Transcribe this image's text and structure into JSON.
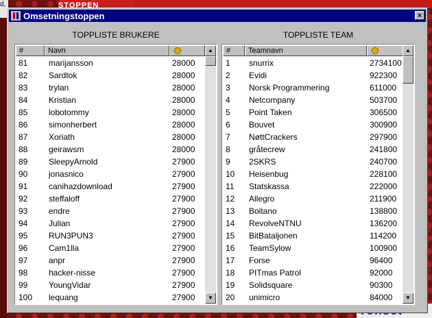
{
  "background": {
    "banner_text": "STOPPEN",
    "corner_text": "d,",
    "bottom_text": "rohset"
  },
  "window": {
    "title": "Omsetningstoppen",
    "close_label": "×"
  },
  "users": {
    "panel_title": "TOPPLISTE BRUKERE",
    "col_rank": "#",
    "col_name": "Navn",
    "col_score_icon": "gold-coin-icon",
    "rows": [
      [
        "81",
        "marijansson",
        "28000"
      ],
      [
        "82",
        "Sardtok",
        "28000"
      ],
      [
        "83",
        "trylan",
        "28000"
      ],
      [
        "84",
        "Kristian",
        "28000"
      ],
      [
        "85",
        "lobotommy",
        "28000"
      ],
      [
        "86",
        "simonherbert",
        "28000"
      ],
      [
        "87",
        "Xoriath",
        "28000"
      ],
      [
        "88",
        "geirawsm",
        "28000"
      ],
      [
        "89",
        "SleepyArnold",
        "27900"
      ],
      [
        "90",
        "jonasnico",
        "27900"
      ],
      [
        "91",
        "canihazdownload",
        "27900"
      ],
      [
        "92",
        "steffaloff",
        "27900"
      ],
      [
        "93",
        "endre",
        "27900"
      ],
      [
        "94",
        "Julian",
        "27900"
      ],
      [
        "95",
        "RUN3PUN3",
        "27900"
      ],
      [
        "96",
        "Cam1lla",
        "27900"
      ],
      [
        "97",
        "anpr",
        "27900"
      ],
      [
        "98",
        "hacker-nisse",
        "27900"
      ],
      [
        "99",
        "YoungVidar",
        "27900"
      ],
      [
        "100",
        "lequang",
        "27900"
      ]
    ]
  },
  "teams": {
    "panel_title": "TOPPLISTE TEAM",
    "col_rank": "#",
    "col_name": "Teamnavn",
    "col_score_icon": "gold-coin-icon",
    "rows": [
      [
        "1",
        "snurrix",
        "2734100"
      ],
      [
        "2",
        "Evidi",
        "922300"
      ],
      [
        "3",
        "Norsk Programmering",
        "611000"
      ],
      [
        "4",
        "Netcompany",
        "503700"
      ],
      [
        "5",
        "Point Taken",
        "306500"
      ],
      [
        "6",
        "Bouvet",
        "300900"
      ],
      [
        "7",
        "NøttCrackers",
        "297900"
      ],
      [
        "8",
        "gråtecrew",
        "241800"
      ],
      [
        "9",
        "2SKRS",
        "240700"
      ],
      [
        "10",
        "Heisenbug",
        "228100"
      ],
      [
        "11",
        "Statskassa",
        "222000"
      ],
      [
        "12",
        "Allegro",
        "211900"
      ],
      [
        "13",
        "Boitano",
        "138800"
      ],
      [
        "14",
        "RevolveNTNU",
        "136200"
      ],
      [
        "15",
        "BitBataljonen",
        "114200"
      ],
      [
        "16",
        "TeamSylow",
        "100900"
      ],
      [
        "17",
        "Forse",
        "96400"
      ],
      [
        "18",
        "PITmas Patrol",
        "92000"
      ],
      [
        "19",
        "Solidsquare",
        "90300"
      ],
      [
        "20",
        "unimicro",
        "84000"
      ]
    ]
  }
}
